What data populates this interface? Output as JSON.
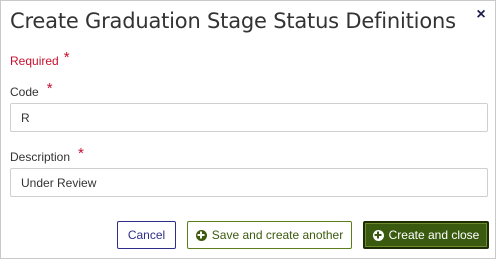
{
  "dialog": {
    "title": "Create Graduation Stage Status Definitions",
    "close_symbol": "×"
  },
  "required_note": {
    "label": "Required",
    "marker": "*"
  },
  "fields": {
    "code": {
      "label": "Code",
      "marker": "*",
      "value": "R"
    },
    "description": {
      "label": "Description",
      "marker": "*",
      "value": "Under Review"
    }
  },
  "buttons": {
    "cancel_label": "Cancel",
    "save_another_label": "Save and create another",
    "create_close_label": "Create and close"
  },
  "icons": {
    "close": "close-icon",
    "save_another": "plus-circle-icon",
    "create_close": "plus-circle-icon"
  },
  "colors": {
    "required": "#c8102e",
    "primary_button": "#3a5a10",
    "cancel_border": "#2e2e8a",
    "secondary_border": "#5b7e1b"
  }
}
